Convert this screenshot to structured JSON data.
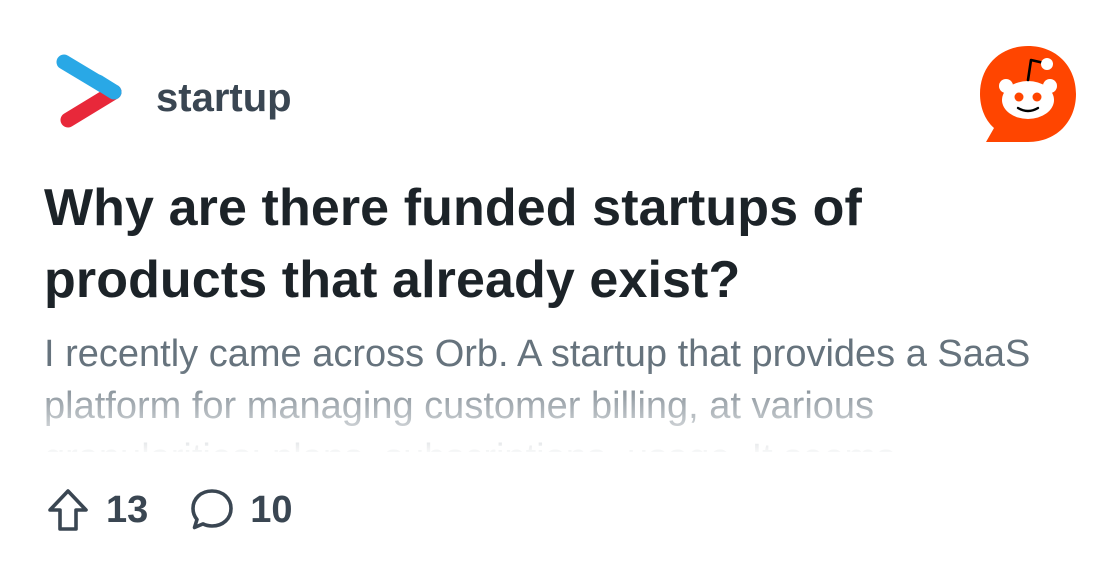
{
  "subreddit": {
    "name": "startup",
    "logo_icon": "chevron-arrow-logo-icon",
    "logo_colors": {
      "top": "#29a8e6",
      "bottom": "#e8283a"
    }
  },
  "brand": {
    "icon": "reddit-snoo-logo-icon",
    "color": "#ff4500"
  },
  "post": {
    "title": "Why are there funded startups of products that already exist?",
    "excerpt": "I recently came across Orb. A startup that provides a SaaS platform for managing customer billing, at various granularities: plans, subscriptions, usage. It seems"
  },
  "stats": {
    "upvote_icon": "upvote-arrow-icon",
    "upvotes": "13",
    "comment_icon": "comment-bubble-icon",
    "comments": "10"
  },
  "colors": {
    "title": "#1c2328",
    "excerpt": "#66737d",
    "meta": "#3a4652"
  }
}
